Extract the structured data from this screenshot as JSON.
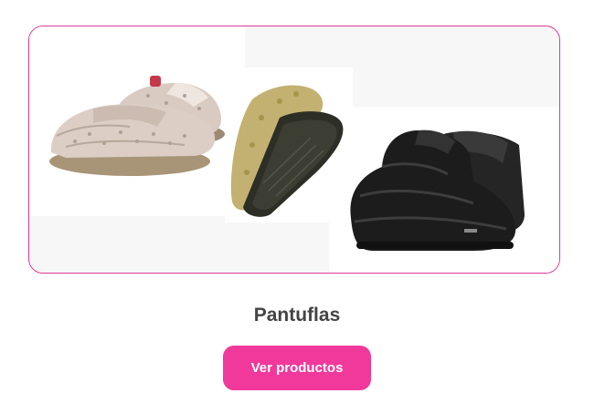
{
  "category": {
    "title": "Pantuflas",
    "button_label": "Ver productos",
    "images": [
      {
        "name": "beige-leopard-slippers",
        "color": "#d6c8bf"
      },
      {
        "name": "olive-slipper-sole",
        "color": "#b5a468"
      },
      {
        "name": "black-quilted-booties",
        "color": "#1e1e1e"
      }
    ]
  },
  "colors": {
    "accent": "#f0399a",
    "border": "#e0389a",
    "title": "#444444"
  }
}
